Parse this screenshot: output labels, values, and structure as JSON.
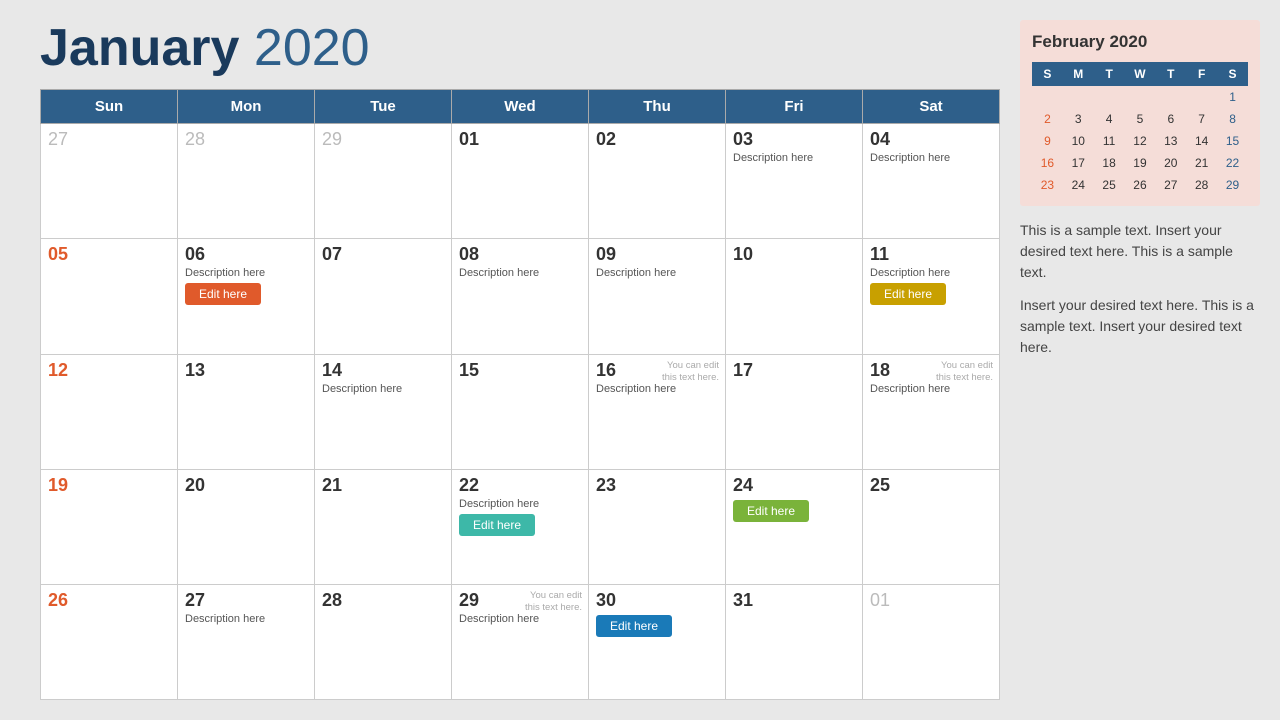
{
  "header": {
    "title_bold": "January",
    "title_year": "2020"
  },
  "weekdays": [
    "Sun",
    "Mon",
    "Tue",
    "Wed",
    "Thu",
    "Fri",
    "Sat"
  ],
  "rows": [
    {
      "days": [
        {
          "num": "27",
          "type": "other-month",
          "desc": "",
          "btn": null,
          "hint": null
        },
        {
          "num": "28",
          "type": "other-month",
          "desc": "",
          "btn": null,
          "hint": null
        },
        {
          "num": "29",
          "type": "other-month",
          "desc": "",
          "btn": null,
          "hint": null
        },
        {
          "num": "01",
          "type": "normal",
          "desc": "",
          "btn": null,
          "hint": null
        },
        {
          "num": "02",
          "type": "normal",
          "desc": "",
          "btn": null,
          "hint": null
        },
        {
          "num": "03",
          "type": "normal",
          "desc": "Description here",
          "btn": null,
          "hint": null
        },
        {
          "num": "04",
          "type": "normal",
          "desc": "Description here",
          "btn": null,
          "hint": null
        }
      ]
    },
    {
      "days": [
        {
          "num": "05",
          "type": "sunday",
          "desc": "",
          "btn": null,
          "hint": null
        },
        {
          "num": "06",
          "type": "normal",
          "desc": "Description here",
          "btn": {
            "label": "Edit here",
            "color": "btn-orange"
          },
          "hint": null
        },
        {
          "num": "07",
          "type": "normal",
          "desc": "",
          "btn": null,
          "hint": null
        },
        {
          "num": "08",
          "type": "normal",
          "desc": "Description here",
          "btn": null,
          "hint": null
        },
        {
          "num": "09",
          "type": "normal",
          "desc": "Description here",
          "btn": null,
          "hint": null
        },
        {
          "num": "10",
          "type": "normal",
          "desc": "",
          "btn": null,
          "hint": null
        },
        {
          "num": "11",
          "type": "normal",
          "desc": "Description here",
          "btn": {
            "label": "Edit here",
            "color": "btn-gold"
          },
          "hint": null
        }
      ]
    },
    {
      "days": [
        {
          "num": "12",
          "type": "sunday",
          "desc": "",
          "btn": null,
          "hint": null
        },
        {
          "num": "13",
          "type": "normal",
          "desc": "",
          "btn": null,
          "hint": null
        },
        {
          "num": "14",
          "type": "normal",
          "desc": "Description here",
          "btn": null,
          "hint": null
        },
        {
          "num": "15",
          "type": "normal",
          "desc": "",
          "btn": null,
          "hint": null
        },
        {
          "num": "16",
          "type": "normal",
          "desc": "Description here",
          "btn": null,
          "hint": "You can edit\nthis text here."
        },
        {
          "num": "17",
          "type": "normal",
          "desc": "",
          "btn": null,
          "hint": null
        },
        {
          "num": "18",
          "type": "normal",
          "desc": "Description here",
          "btn": null,
          "hint": "You can edit\nthis text here."
        }
      ]
    },
    {
      "days": [
        {
          "num": "19",
          "type": "sunday",
          "desc": "",
          "btn": null,
          "hint": null
        },
        {
          "num": "20",
          "type": "normal",
          "desc": "",
          "btn": null,
          "hint": null
        },
        {
          "num": "21",
          "type": "normal",
          "desc": "",
          "btn": null,
          "hint": null
        },
        {
          "num": "22",
          "type": "normal",
          "desc": "Description here",
          "btn": {
            "label": "Edit here",
            "color": "btn-teal"
          },
          "hint": null
        },
        {
          "num": "23",
          "type": "normal",
          "desc": "",
          "btn": null,
          "hint": null
        },
        {
          "num": "24",
          "type": "normal",
          "desc": "",
          "btn": {
            "label": "Edit here",
            "color": "btn-green"
          },
          "hint": null
        },
        {
          "num": "25",
          "type": "normal",
          "desc": "",
          "btn": null,
          "hint": null
        }
      ]
    },
    {
      "days": [
        {
          "num": "26",
          "type": "sunday",
          "desc": "",
          "btn": null,
          "hint": null
        },
        {
          "num": "27",
          "type": "normal",
          "desc": "Description here",
          "btn": null,
          "hint": null
        },
        {
          "num": "28",
          "type": "normal",
          "desc": "",
          "btn": null,
          "hint": null
        },
        {
          "num": "29",
          "type": "normal",
          "desc": "Description here",
          "btn": null,
          "hint": "You can edit\nthis text here."
        },
        {
          "num": "30",
          "type": "normal",
          "desc": "",
          "btn": {
            "label": "Edit here",
            "color": "btn-blue"
          },
          "hint": null
        },
        {
          "num": "31",
          "type": "normal",
          "desc": "",
          "btn": null,
          "hint": null
        },
        {
          "num": "01",
          "type": "other-month",
          "desc": "",
          "btn": null,
          "hint": null
        }
      ]
    }
  ],
  "mini_cal": {
    "title": "February 2020",
    "headers": [
      "S",
      "M",
      "T",
      "W",
      "T",
      "F",
      "S"
    ],
    "rows": [
      [
        "",
        "",
        "",
        "",
        "",
        "",
        "1"
      ],
      [
        "2",
        "3",
        "4",
        "5",
        "6",
        "7",
        "8"
      ],
      [
        "9",
        "10",
        "11",
        "12",
        "13",
        "14",
        "15"
      ],
      [
        "16",
        "17",
        "18",
        "19",
        "20",
        "21",
        "22"
      ],
      [
        "23",
        "24",
        "25",
        "26",
        "27",
        "28",
        "29"
      ]
    ]
  },
  "text_blocks": [
    "This is a sample text. Insert your desired text here. This is a sample text.",
    "Insert your desired text here. This is a sample text. Insert your desired text here."
  ]
}
